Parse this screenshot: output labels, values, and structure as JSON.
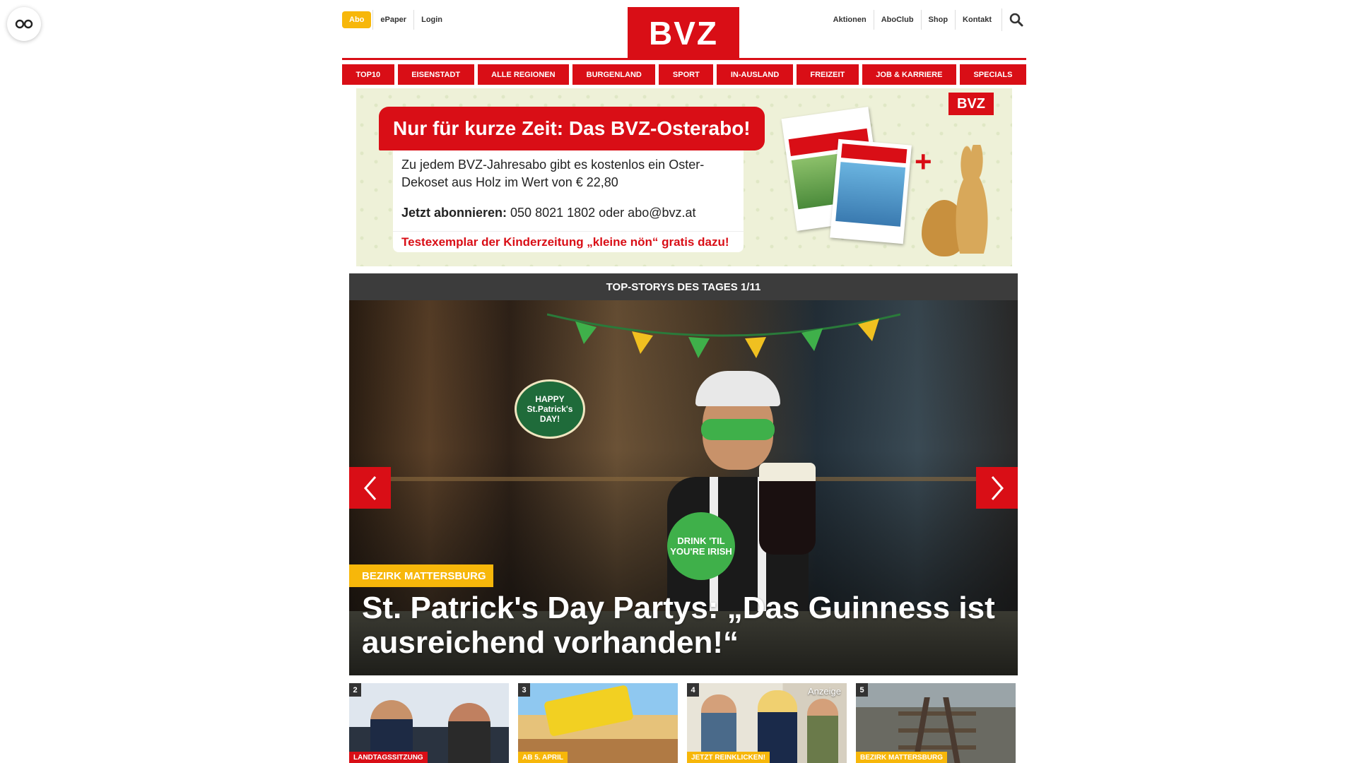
{
  "accessibility": {
    "icon": "glasses-icon"
  },
  "header": {
    "abo_label": "Abo",
    "epaper_label": "ePaper",
    "login_label": "Login",
    "logo_text": "BVZ",
    "right_links": [
      "Aktionen",
      "AboClub",
      "Shop",
      "Kontakt"
    ],
    "search_icon": "search-icon"
  },
  "colors": {
    "brand_red": "#d90e16",
    "accent_yellow": "#f7b70a",
    "dark_bar": "#3c3c3c"
  },
  "nav": {
    "items": [
      "TOP10",
      "EISENSTADT",
      "ALLE REGIONEN",
      "BURGENLAND",
      "SPORT",
      "IN-AUSLAND",
      "FREIZEIT",
      "JOB & KARRIERE",
      "SPECIALS"
    ]
  },
  "banner": {
    "headline": "Nur für kurze Zeit: Das BVZ-Osterabo!",
    "text": "Zu jedem BVZ-Jahresabo gibt es kostenlos ein Oster-Dekoset aus Holz im Wert von € 22,80",
    "cta_bold": "Jetzt abonnieren:",
    "cta_rest": " 050 8021 1802 oder abo@bvz.at",
    "strip": "Testexemplar der Kinderzeitung „kleine nön“ gratis dazu!",
    "logo": "BVZ",
    "plus": "+"
  },
  "slider": {
    "heading": "TOP-STORYS DES TAGES 1/11",
    "category": "BEZIRK MATTERSBURG",
    "title": "St. Patrick's Day Partys: „Das Guinness ist ausreichend vorhanden!“",
    "sign_text": "HAPPY St.Patrick's DAY!",
    "green_sign_text": "DRINK 'TIL YOU'RE IRISH"
  },
  "teasers": [
    {
      "num": "2",
      "tag": "LANDTAGSSITZUNG",
      "tag_color": "red"
    },
    {
      "num": "3",
      "tag": "AB 5. APRIL",
      "tag_color": "yellow"
    },
    {
      "num": "4",
      "tag": "JETZT REINKLICKEN!",
      "tag_color": "yellow",
      "ad": "Anzeige"
    },
    {
      "num": "5",
      "tag": "BEZIRK MATTERSBURG",
      "tag_color": "yellow"
    }
  ]
}
